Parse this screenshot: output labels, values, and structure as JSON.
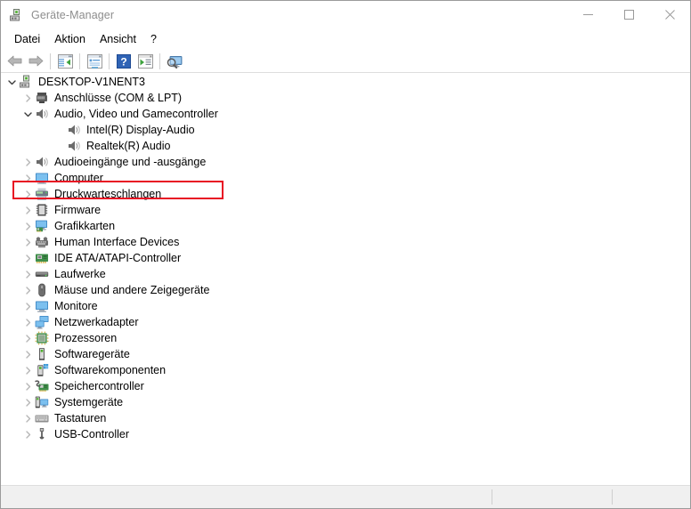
{
  "window": {
    "title": "Geräte-Manager",
    "icon": "device-manager-icon"
  },
  "caption_buttons": [
    {
      "name": "minimize-button",
      "glyph": "minimize-icon",
      "label": "Minimieren"
    },
    {
      "name": "maximize-button",
      "glyph": "maximize-icon",
      "label": "Maximieren"
    },
    {
      "name": "close-button",
      "glyph": "close-icon",
      "label": "Schließen"
    }
  ],
  "menubar": {
    "items": [
      {
        "name": "menu-datei",
        "label": "Datei"
      },
      {
        "name": "menu-aktion",
        "label": "Aktion"
      },
      {
        "name": "menu-ansicht",
        "label": "Ansicht"
      },
      {
        "name": "menu-hilfe",
        "label": "?"
      }
    ]
  },
  "toolbar": {
    "items": [
      {
        "name": "back-button",
        "icon": "back-arrow-icon"
      },
      {
        "name": "forward-button",
        "icon": "forward-arrow-icon"
      },
      {
        "name": "separator-1",
        "icon": "separator"
      },
      {
        "name": "show-hide-console-tree-button",
        "icon": "console-tree-icon"
      },
      {
        "name": "separator-2",
        "icon": "separator"
      },
      {
        "name": "properties-button",
        "icon": "properties-icon"
      },
      {
        "name": "separator-3",
        "icon": "separator"
      },
      {
        "name": "help-button",
        "icon": "help-question-icon"
      },
      {
        "name": "update-driver-button",
        "icon": "update-driver-icon"
      },
      {
        "name": "separator-4",
        "icon": "separator"
      },
      {
        "name": "scan-for-hardware-changes-button",
        "icon": "scan-hardware-icon"
      }
    ]
  },
  "tree": {
    "nodes": [
      {
        "label": "DESKTOP-V1NENT3",
        "level": 0,
        "state": "expanded",
        "icon": "computer-device-icon"
      },
      {
        "label": "Anschlüsse (COM & LPT)",
        "level": 1,
        "state": "collapsed",
        "icon": "port-icon"
      },
      {
        "label": "Audio, Video und Gamecontroller",
        "level": 1,
        "state": "expanded",
        "icon": "speaker-icon",
        "highlighted": true
      },
      {
        "label": "Intel(R) Display-Audio",
        "level": 2,
        "state": "leaf",
        "icon": "speaker-icon"
      },
      {
        "label": "Realtek(R) Audio",
        "level": 2,
        "state": "leaf",
        "icon": "speaker-icon"
      },
      {
        "label": "Audioeingänge und -ausgänge",
        "level": 1,
        "state": "collapsed",
        "icon": "speaker-icon"
      },
      {
        "label": "Computer",
        "level": 1,
        "state": "collapsed",
        "icon": "monitor-icon"
      },
      {
        "label": "Druckwarteschlangen",
        "level": 1,
        "state": "collapsed",
        "icon": "printer-icon"
      },
      {
        "label": "Firmware",
        "level": 1,
        "state": "collapsed",
        "icon": "firmware-chip-icon"
      },
      {
        "label": "Grafikkarten",
        "level": 1,
        "state": "collapsed",
        "icon": "display-adapter-icon"
      },
      {
        "label": "Human Interface Devices",
        "level": 1,
        "state": "collapsed",
        "icon": "hid-icon"
      },
      {
        "label": "IDE ATA/ATAPI-Controller",
        "level": 1,
        "state": "collapsed",
        "icon": "ide-controller-icon"
      },
      {
        "label": "Laufwerke",
        "level": 1,
        "state": "collapsed",
        "icon": "disk-drive-icon"
      },
      {
        "label": "Mäuse und andere Zeigegeräte",
        "level": 1,
        "state": "collapsed",
        "icon": "mouse-icon"
      },
      {
        "label": "Monitore",
        "level": 1,
        "state": "collapsed",
        "icon": "monitor-icon"
      },
      {
        "label": "Netzwerkadapter",
        "level": 1,
        "state": "collapsed",
        "icon": "network-adapter-icon"
      },
      {
        "label": "Prozessoren",
        "level": 1,
        "state": "collapsed",
        "icon": "processor-icon"
      },
      {
        "label": "Softwaregeräte",
        "level": 1,
        "state": "collapsed",
        "icon": "software-device-icon"
      },
      {
        "label": "Softwarekomponenten",
        "level": 1,
        "state": "collapsed",
        "icon": "software-component-icon"
      },
      {
        "label": "Speichercontroller",
        "level": 1,
        "state": "collapsed",
        "icon": "storage-controller-icon"
      },
      {
        "label": "Systemgeräte",
        "level": 1,
        "state": "collapsed",
        "icon": "system-device-icon"
      },
      {
        "label": "Tastaturen",
        "level": 1,
        "state": "collapsed",
        "icon": "keyboard-icon"
      },
      {
        "label": "USB-Controller",
        "level": 1,
        "state": "collapsed",
        "icon": "usb-icon"
      }
    ]
  },
  "statusbar": {
    "text": "",
    "panel_2": "",
    "panel_3": ""
  },
  "colors": {
    "highlight_rect": "#e81123",
    "title_text": "#8d8d8d",
    "window_border": "#9b9b9b",
    "statusbar_bg": "#f0f0f0"
  }
}
